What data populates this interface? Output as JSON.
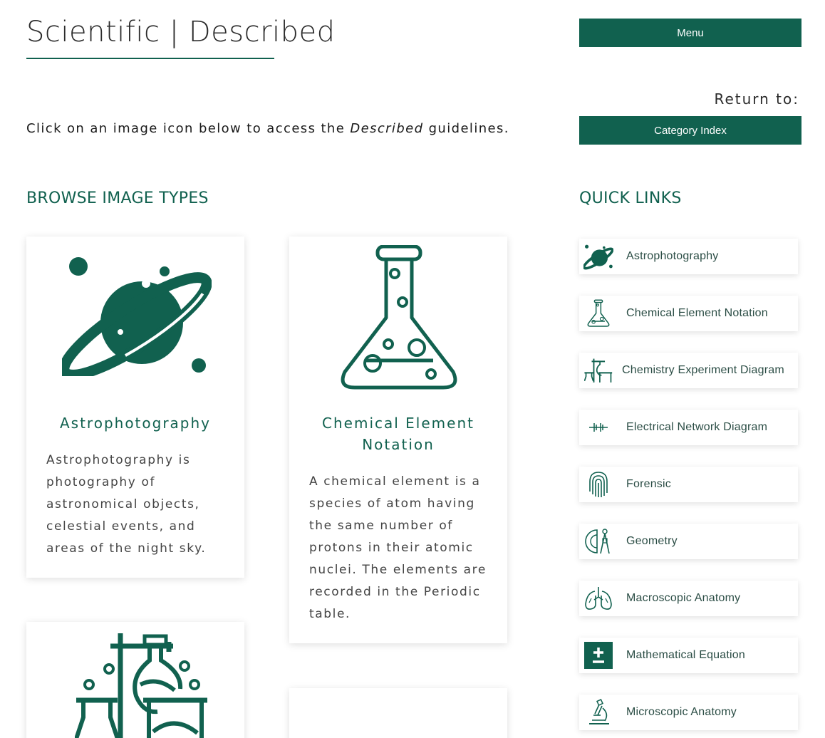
{
  "header": {
    "title": "Scientific | Described",
    "menu_label": "Menu"
  },
  "return": {
    "label": "Return to:",
    "category_index_label": "Category Index"
  },
  "intro": {
    "before": "Click on an image icon below to access the ",
    "emphasis": "Described",
    "after": " guidelines."
  },
  "browse": {
    "heading": "BROWSE IMAGE TYPES",
    "cards": [
      {
        "icon": "planet-icon",
        "title": "Astrophotography",
        "description": "Astrophotography is photography of astronomical objects, celestial events, and areas of the night sky."
      },
      {
        "icon": "flask-icon",
        "title": "Chemical Element Notation",
        "description": "A chemical element is a species of atom having the same number of protons in their atomic nuclei. The elements are recorded in the Periodic table."
      },
      {
        "icon": "lab-equipment-icon",
        "title": "",
        "description": ""
      }
    ]
  },
  "quick_links": {
    "heading": "QUICK LINKS",
    "items": [
      {
        "icon": "planet-icon",
        "label": "Astrophotography"
      },
      {
        "icon": "flask-icon",
        "label": "Chemical Element Notation"
      },
      {
        "icon": "lab-equipment-icon",
        "label": "Chemistry Experiment Diagram"
      },
      {
        "icon": "circuit-icon",
        "label": "Electrical Network Diagram"
      },
      {
        "icon": "fingerprint-icon",
        "label": "Forensic"
      },
      {
        "icon": "compass-protractor-icon",
        "label": "Geometry"
      },
      {
        "icon": "lungs-icon",
        "label": "Macroscopic Anatomy"
      },
      {
        "icon": "plus-minus-icon",
        "label": "Mathematical Equation"
      },
      {
        "icon": "microscope-icon",
        "label": "Microscopic Anatomy"
      }
    ]
  },
  "colors": {
    "brand": "#11614f",
    "text": "#2b2b2b",
    "card_text": "#444444"
  }
}
